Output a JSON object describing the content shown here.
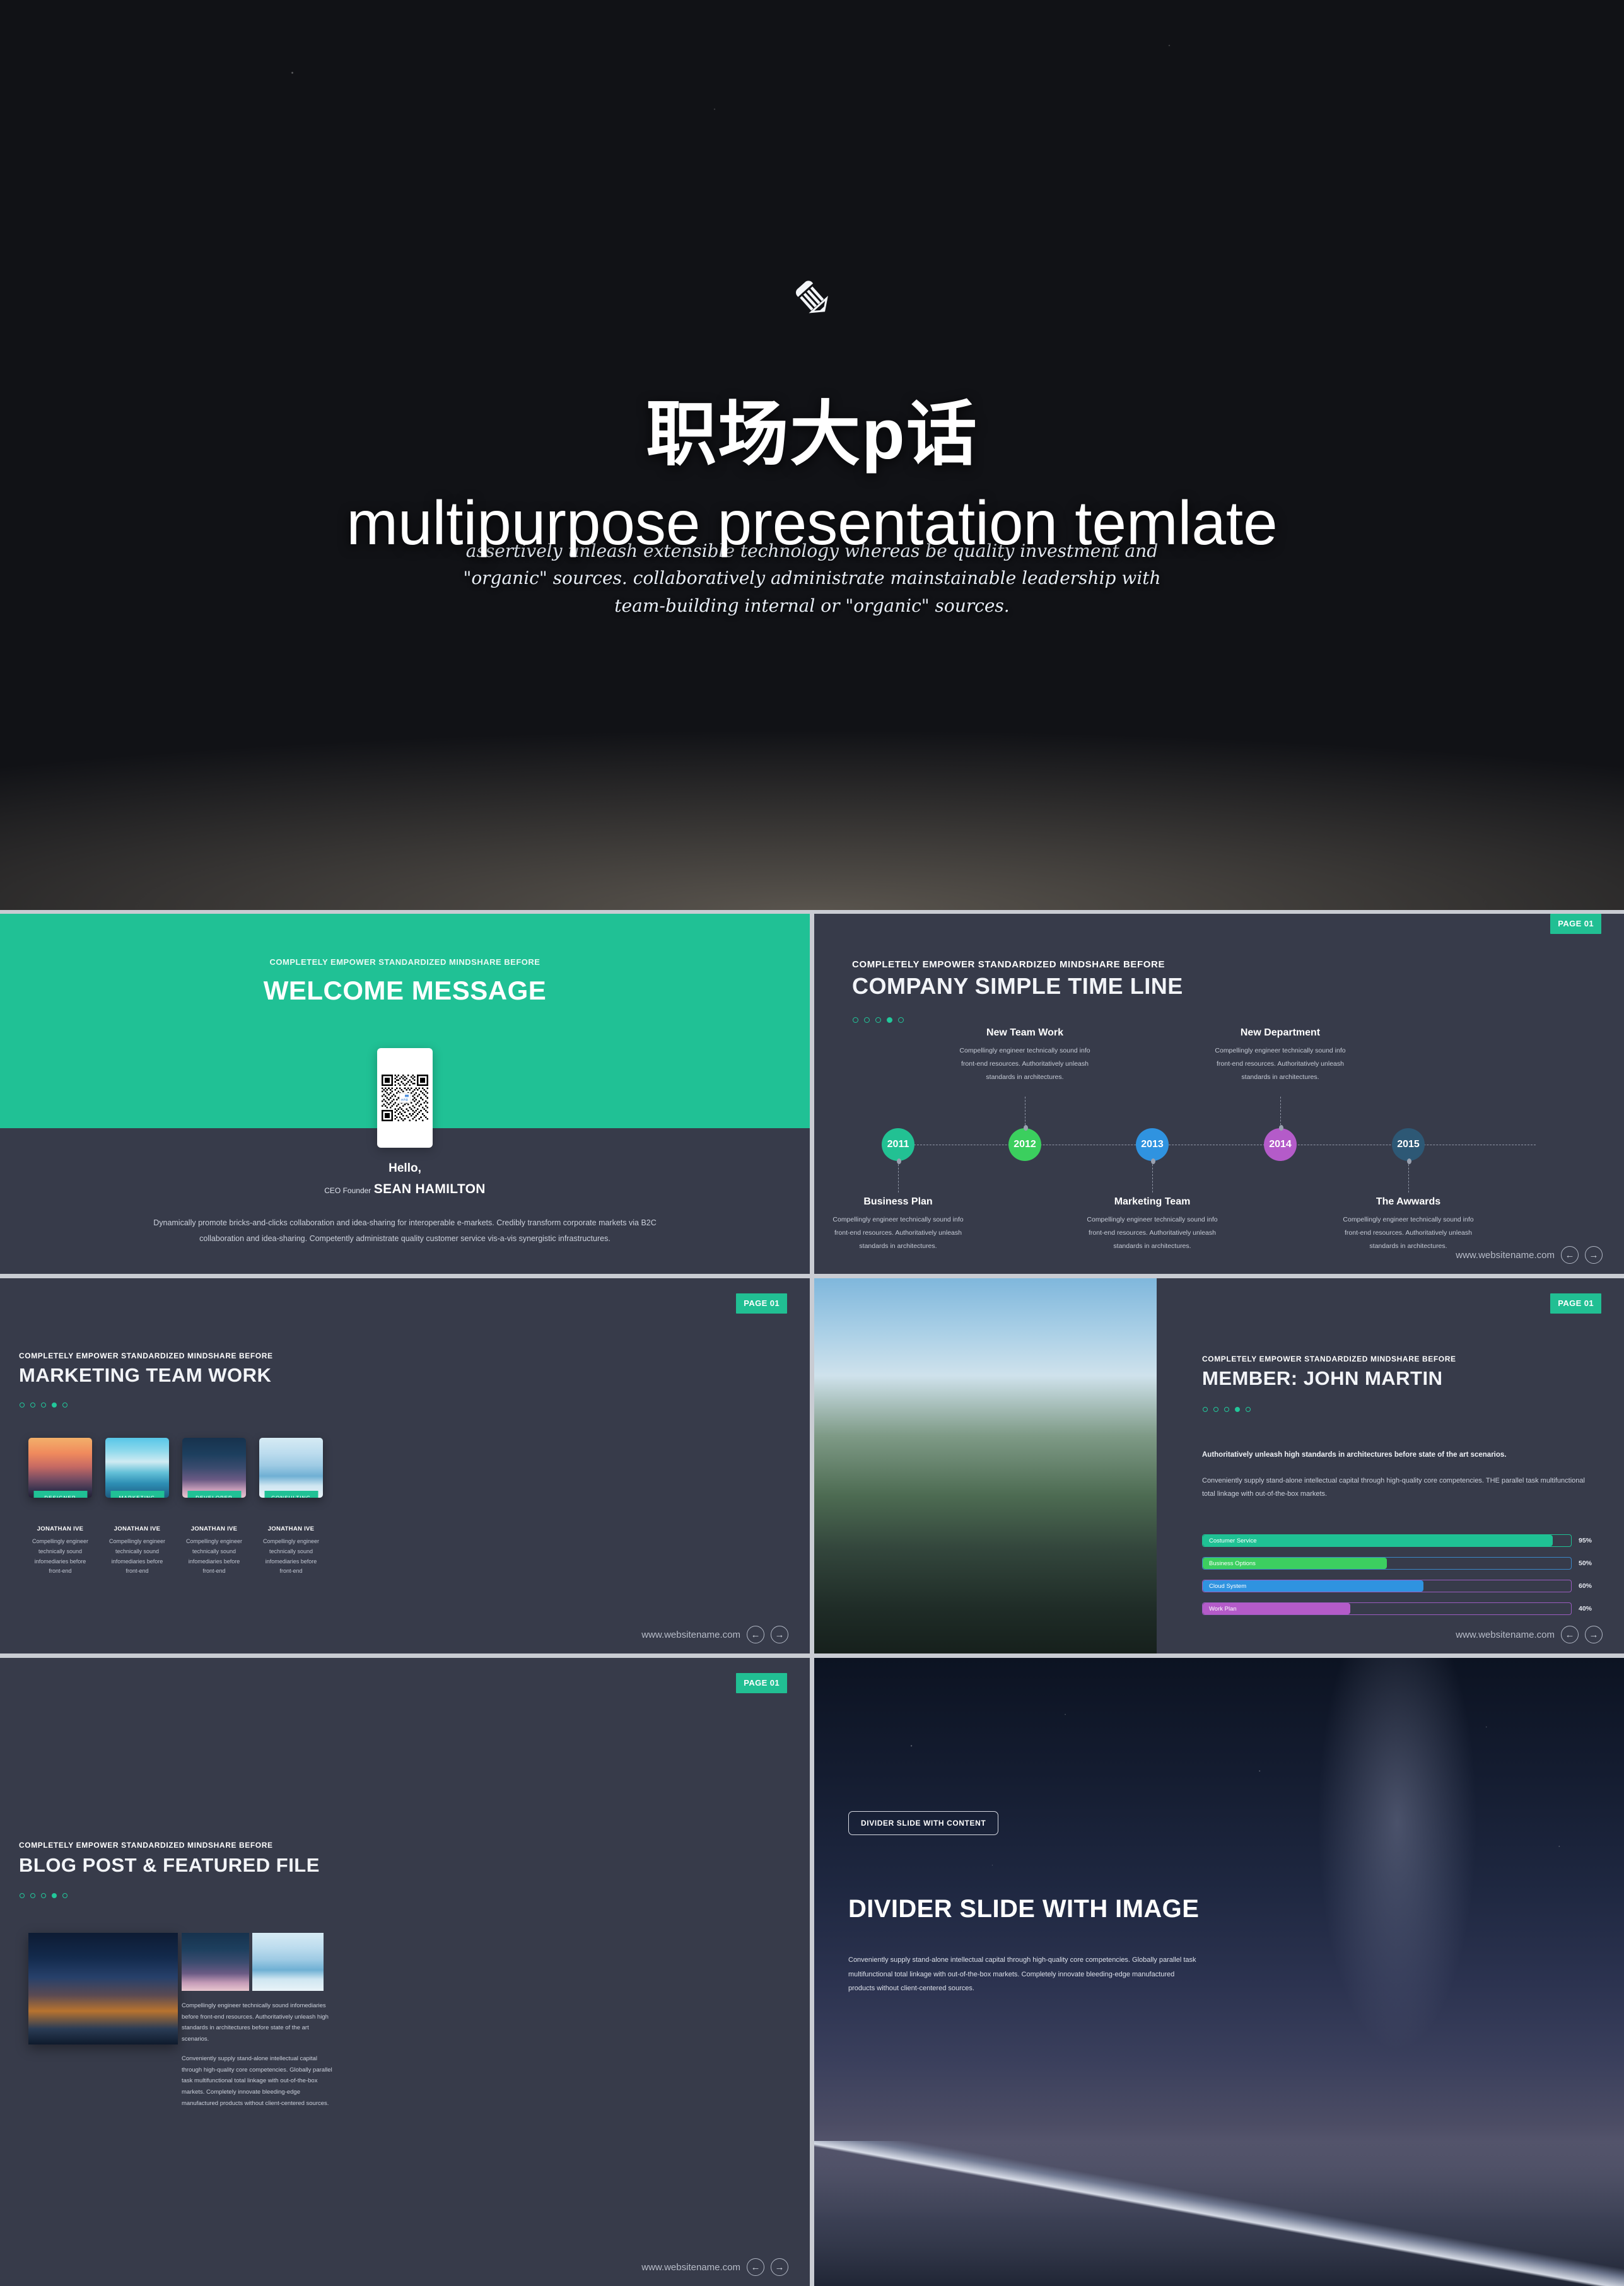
{
  "title_slide": {
    "icon": "pencil-icon",
    "heading_cn": "职场大p话",
    "heading_en": "multipurpose presentation temlate",
    "subtitle_line1": "assertively unleash extensible technology whereas be quality investment and",
    "subtitle_line2": "\"organic\" sources. collaboratively administrate mainstainable leadership with",
    "subtitle_line3": "team-building internal or \"organic\" sources."
  },
  "welcome_slide": {
    "eyebrow": "COMPLETELY EMPOWER STANDARDIZED MINDSHARE BEFORE",
    "title": "WELCOME MESSAGE",
    "qr_label": "职场\n大P话",
    "hello": "Hello,",
    "role": "CEO Founder",
    "name": "SEAN HAMILTON",
    "body": "Dynamically promote bricks-and-clicks collaboration and idea-sharing for interoperable e-markets. Credibly transform corporate markets via B2C collaboration and idea-sharing. Competently administrate quality customer service vis-a-vis synergistic infrastructures.",
    "accent": "#20c195"
  },
  "timeline_slide": {
    "page_badge": "PAGE 01",
    "eyebrow": "COMPLETELY EMPOWER STANDARDIZED MINDSHARE BEFORE",
    "title": "COMPANY SIMPLE TIME LINE",
    "dots": [
      false,
      false,
      false,
      true,
      false
    ],
    "footer_url": "www.websitename.com",
    "nav_prev": "←",
    "nav_next": "→",
    "nodes": [
      {
        "year": "2011",
        "color": "#22c193",
        "position": "below",
        "heading": "Business Plan",
        "text": "Compellingly engineer technically sound info front-end resources. Authoritatively unleash standards in architectures."
      },
      {
        "year": "2012",
        "color": "#3bcf5e",
        "position": "above",
        "heading": "New Team Work",
        "text": "Compellingly engineer technically sound info front-end resources. Authoritatively unleash standards in architectures."
      },
      {
        "year": "2013",
        "color": "#2f93e0",
        "position": "below",
        "heading": "Marketing Team",
        "text": "Compellingly engineer technically sound info front-end resources. Authoritatively unleash standards in architectures."
      },
      {
        "year": "2014",
        "color": "#b45bc9",
        "position": "above",
        "heading": "New Department",
        "text": "Compellingly engineer technically sound info front-end resources. Authoritatively unleash standards in architectures."
      },
      {
        "year": "2015",
        "color": "#2d5875",
        "position": "below",
        "heading": "The Awwards",
        "text": "Compellingly engineer technically sound info front-end resources. Authoritatively unleash standards in architectures."
      }
    ]
  },
  "team_slide": {
    "page_badge": "PAGE 01",
    "eyebrow": "COMPLETELY EMPOWER STANDARDIZED MINDSHARE BEFORE",
    "title": "MARKETING TEAM WORK",
    "dots": [
      false,
      false,
      false,
      true,
      false
    ],
    "footer_url": "www.websitename.com",
    "nav_prev": "←",
    "nav_next": "→",
    "members": [
      {
        "chip": "DESIGNER",
        "name": "JONATHAN IVE",
        "text": "Compellingly engineer technically sound infomediaries before front-end"
      },
      {
        "chip": "MARKETING",
        "name": "JONATHAN IVE",
        "text": "Compellingly engineer technically sound infomediaries before front-end"
      },
      {
        "chip": "DEVELOPER",
        "name": "JONATHAN IVE",
        "text": "Compellingly engineer technically sound infomediaries before front-end"
      },
      {
        "chip": "CONSULTING",
        "name": "JONATHAN IVE",
        "text": "Compellingly engineer technically sound infomediaries before front-end"
      }
    ]
  },
  "member_slide": {
    "page_badge": "PAGE 01",
    "eyebrow": "COMPLETELY EMPOWER STANDARDIZED MINDSHARE BEFORE",
    "title": "MEMBER: JOHN MARTIN",
    "dots": [
      false,
      false,
      false,
      true,
      false
    ],
    "lead": "Authoritatively unleash high standards in architectures before state of the art scenarios.",
    "body": "Conveniently supply stand-alone intellectual capital through high-quality core competencies. THE parallel task multifunctional total linkage with out-of-the-box markets.",
    "footer_url": "www.websitename.com",
    "nav_prev": "←",
    "nav_next": "→",
    "chart_data": {
      "type": "bar",
      "orientation": "horizontal",
      "title": "Skill proficiency bars",
      "categories": [
        "Costumer Service",
        "Business Options",
        "Cloud System",
        "Work Plan"
      ],
      "values": [
        95,
        50,
        60,
        40
      ],
      "value_labels": [
        "95%",
        "50%",
        "60%",
        "40%"
      ],
      "fill_colors": [
        "#1fc194",
        "#3ccf60",
        "#2f93e0",
        "#b45bc9"
      ],
      "track_border_colors": [
        "#1fc194",
        "#3b87c8",
        "#9b5cc0",
        "#9b5cc0"
      ],
      "xlim": [
        0,
        100
      ],
      "xlabel": "",
      "ylabel": "",
      "grid": false,
      "legend": false
    }
  },
  "blog_slide": {
    "page_badge": "PAGE 01",
    "eyebrow": "COMPLETELY EMPOWER STANDARDIZED MINDSHARE BEFORE",
    "title": "BLOG POST & FEATURED FILE",
    "dots": [
      false,
      false,
      false,
      true,
      false
    ],
    "para1": "Compellingly engineer technically sound infomediaries before front-end resources. Authoritatively unleash high standards in architectures before state of the art scenarios.",
    "para2": "Conveniently supply stand-alone intellectual capital through high-quality core competencies. Globally parallel task multifunctional total linkage with out-of-the-box markets. Completely innovate bleeding-edge manufactured products without client-centered sources.",
    "footer_url": "www.websitename.com",
    "nav_prev": "←",
    "nav_next": "→"
  },
  "divider_slide": {
    "chip": "DIVIDER SLIDE WITH CONTENT",
    "title": "DIVIDER SLIDE WITH IMAGE",
    "body": "Conveniently supply stand-alone intellectual capital through high-quality core competencies. Globally parallel task multifunctional total linkage with out-of-the-box markets. Completely innovate bleeding-edge manufactured products without client-centered sources."
  }
}
